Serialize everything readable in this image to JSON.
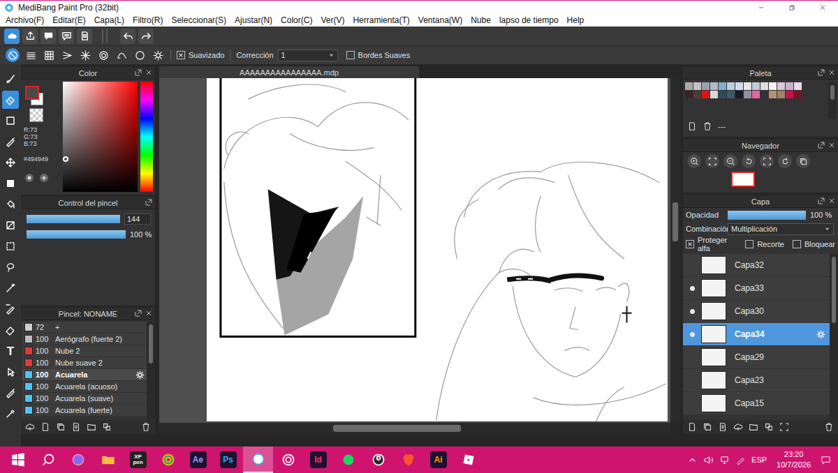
{
  "window": {
    "title": "MediBang Paint Pro (32bit)"
  },
  "menu": [
    "Archivo(F)",
    "Editar(E)",
    "Capa(L)",
    "Filtro(R)",
    "Seleccionar(S)",
    "Ajustar(N)",
    "Color(C)",
    "Ver(V)",
    "Herramienta(T)",
    "Ventana(W)",
    "Nube",
    "lapso de tiempo",
    "Help"
  ],
  "toolbar": [
    {
      "kind": "cloud",
      "selected": true
    },
    {
      "kind": "export",
      "selected": false
    },
    {
      "kind": "comment",
      "selected": false
    },
    {
      "kind": "comments",
      "selected": false
    },
    {
      "kind": "page",
      "selected": false
    },
    {
      "kind": "undo",
      "selected": false
    },
    {
      "kind": "redo",
      "selected": false
    }
  ],
  "options": {
    "shapes": [
      {
        "kind": "none",
        "selected": true
      },
      {
        "kind": "parallel",
        "selected": false
      },
      {
        "kind": "grid",
        "selected": false
      },
      {
        "kind": "fan",
        "selected": false
      },
      {
        "kind": "burst",
        "selected": false
      },
      {
        "kind": "concentric",
        "selected": false
      },
      {
        "kind": "curve",
        "selected": false
      },
      {
        "kind": "circle",
        "selected": false
      },
      {
        "kind": "settings",
        "selected": false
      }
    ],
    "antialias": {
      "label": "Suavizado",
      "checked": true
    },
    "correction": {
      "label": "Corrección",
      "value": "1"
    },
    "soft_edges": {
      "label": "Bordes Suaves",
      "checked": false
    }
  },
  "tools": [
    {
      "kind": "brush",
      "selected": false
    },
    {
      "kind": "eraser",
      "selected": true
    },
    {
      "kind": "rect",
      "selected": false
    },
    {
      "kind": "pen",
      "selected": false
    },
    {
      "kind": "move",
      "selected": false
    },
    {
      "kind": "fillrect",
      "selected": false
    },
    {
      "kind": "bucket",
      "selected": false
    },
    {
      "kind": "gradient",
      "selected": false
    },
    {
      "kind": "select",
      "selected": false
    },
    {
      "kind": "lasso",
      "selected": false
    },
    {
      "kind": "wand",
      "selected": false
    },
    {
      "kind": "selpen",
      "selected": false
    },
    {
      "kind": "seleraser",
      "selected": false
    },
    {
      "kind": "text",
      "label": "T",
      "selected": false
    },
    {
      "kind": "pointer",
      "selected": false
    },
    {
      "kind": "pen",
      "selected": false
    },
    {
      "kind": "dropper",
      "selected": false
    }
  ],
  "color_panel": {
    "title": "Color",
    "rgb": [
      "R:73",
      "G:73",
      "B:73"
    ],
    "hex": "#494949",
    "secondary": "#ffffff",
    "hue": "#ff0000",
    "saturation": 0.02,
    "brightness": 0.29
  },
  "brush_control": {
    "title": "Control del pincel",
    "sliders": [
      {
        "value": "144",
        "level": 1
      },
      {
        "value": "100 %",
        "level": 1
      }
    ]
  },
  "brushes": {
    "title": "Pincel: NONAME",
    "items": [
      {
        "size": "72",
        "name": "+",
        "color": "#cfcfcf",
        "selected": false
      },
      {
        "size": "100",
        "name": "Aerógrafo (fuerte 2)",
        "color": "#bdbdbd",
        "selected": false
      },
      {
        "size": "100",
        "name": "Nube 2",
        "color": "#e53935",
        "selected": false
      },
      {
        "size": "100",
        "name": "Nube suave 2",
        "color": "#e53935",
        "selected": false
      },
      {
        "size": "100",
        "name": "Acuarela",
        "color": "#4fc3f7",
        "selected": true
      },
      {
        "size": "100",
        "name": "Acuarela (acuoso)",
        "color": "#4fc3f7",
        "selected": false
      },
      {
        "size": "100",
        "name": "Acuarela (suave)",
        "color": "#4fc3f7",
        "selected": false
      },
      {
        "size": "100",
        "name": "Acuarela (fuerte)",
        "color": "#4fc3f7",
        "selected": false
      }
    ]
  },
  "canvas": {
    "tab": "AAAAAAAAAAAAAAAA.mdp"
  },
  "palette": {
    "title": "Paleta",
    "label": "---",
    "colors": [
      "#a9a9a9",
      "#c4c4c4",
      "#9aa3ad",
      "#b3bcc6",
      "#7fb1c9",
      "#b8d1e0",
      "#d3dbe8",
      "#e8e8e8",
      "#c2cad8",
      "#dedede",
      "#f2f2f2",
      "#d9c8d9",
      "#c6b4c6",
      "#ead9ea",
      "#3b2222",
      "#4b3b3b",
      "#e01414",
      "#d8d8d8",
      "#31495a",
      "#41596a",
      "#1b1b2b",
      "#9191a1",
      "#e466a4",
      "#303042",
      "#b29272",
      "#a28262",
      "#c4124a",
      "#7a1222"
    ]
  },
  "navigator": {
    "title": "Navegador"
  },
  "layers": {
    "title": "Capa",
    "opacity_label": "Opacidad",
    "opacity": {
      "value": "100 %",
      "level": 1
    },
    "blend_label": "Combinación",
    "blend": "Multiplicación",
    "options": [
      {
        "label": "Proteger alfa",
        "checked": true
      },
      {
        "label": "Recorte",
        "checked": false
      },
      {
        "label": "Bloquear",
        "checked": false
      }
    ],
    "items": [
      {
        "name": "Capa32",
        "visible": false,
        "selected": false
      },
      {
        "name": "Capa33",
        "visible": true,
        "selected": false
      },
      {
        "name": "Capa30",
        "visible": true,
        "selected": false
      },
      {
        "name": "Capa34",
        "visible": true,
        "selected": true
      },
      {
        "name": "Capa29",
        "visible": false,
        "selected": false
      },
      {
        "name": "Capa23",
        "visible": false,
        "selected": false
      },
      {
        "name": "Capa15",
        "visible": false,
        "selected": false
      }
    ]
  },
  "taskbar": {
    "apps": [
      {
        "kind": "start",
        "active": false
      },
      {
        "kind": "search",
        "active": false
      },
      {
        "kind": "chat",
        "active": false
      },
      {
        "kind": "folder",
        "active": false
      },
      {
        "kind": "xppen",
        "label": "XP pen",
        "color": "#ffffff",
        "active": false
      },
      {
        "kind": "chrome",
        "active": false
      },
      {
        "kind": "ae",
        "label": "Ae",
        "color": "#9999ff",
        "active": false
      },
      {
        "kind": "ps",
        "label": "Ps",
        "color": "#31a8ff",
        "active": false
      },
      {
        "kind": "medibang",
        "active": true
      },
      {
        "kind": "ring",
        "active": false
      },
      {
        "kind": "id",
        "label": "Id",
        "color": "#ff3366",
        "active": false
      },
      {
        "kind": "spotify",
        "active": false
      },
      {
        "kind": "obs",
        "active": false
      },
      {
        "kind": "brave",
        "active": false
      },
      {
        "kind": "ai",
        "label": "Ai",
        "color": "#ff9a00",
        "active": false
      },
      {
        "kind": "roblox",
        "active": false
      }
    ],
    "language": "ESP",
    "time": "23:20",
    "date": "10/7/2026"
  }
}
